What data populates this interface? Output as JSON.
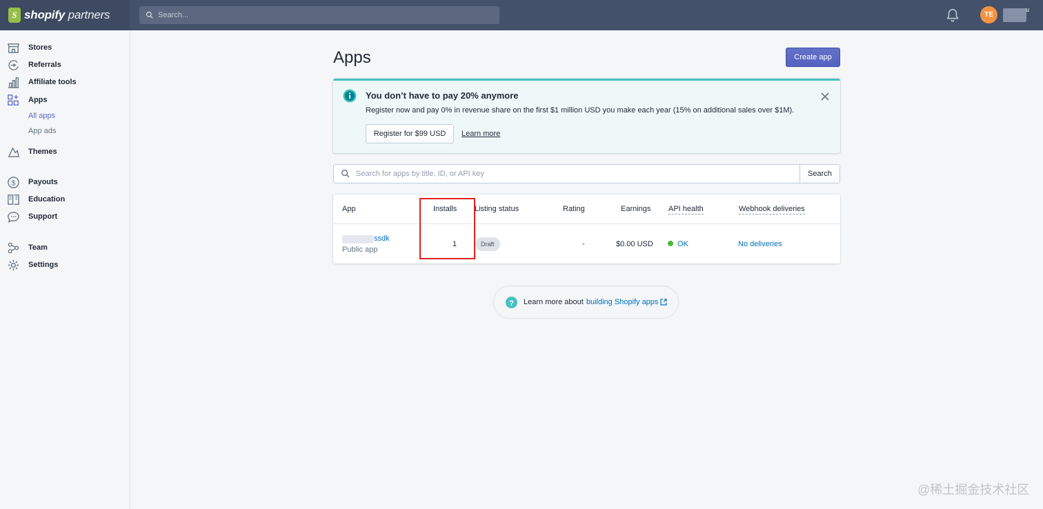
{
  "topbar": {
    "logo_mark": "S",
    "logo_brand": "shopify",
    "logo_product": "partners",
    "search_placeholder": "Search...",
    "avatar_initials": "TE",
    "account_suffix": "u"
  },
  "sidebar": {
    "items": [
      {
        "label": "Stores",
        "icon": "store-icon"
      },
      {
        "label": "Referrals",
        "icon": "referrals-icon"
      },
      {
        "label": "Affiliate tools",
        "icon": "affiliate-tools-icon"
      },
      {
        "label": "Apps",
        "icon": "apps-icon"
      },
      {
        "label": "Themes",
        "icon": "themes-icon"
      },
      {
        "label": "Payouts",
        "icon": "payouts-icon"
      },
      {
        "label": "Education",
        "icon": "education-icon"
      },
      {
        "label": "Support",
        "icon": "support-icon"
      },
      {
        "label": "Team",
        "icon": "team-icon"
      },
      {
        "label": "Settings",
        "icon": "gear-icon"
      }
    ],
    "apps_sub": [
      {
        "label": "All apps",
        "active": true
      },
      {
        "label": "App ads",
        "active": false
      }
    ]
  },
  "main": {
    "title": "Apps",
    "create_button": "Create app",
    "banner": {
      "title": "You don’t have to pay 20% anymore",
      "text": "Register now and pay 0% in revenue share on the first $1 million USD you make each year (15% on additional sales over $1M).",
      "button": "Register for $99 USD",
      "link": "Learn more"
    },
    "search": {
      "placeholder": "Search for apps by title, ID, or API key",
      "button": "Search"
    },
    "table": {
      "headers": {
        "app": "App",
        "installs": "Installs",
        "listing_status": "Listing status",
        "rating": "Rating",
        "earnings": "Earnings",
        "api_health": "API health",
        "webhook": "Webhook deliveries"
      },
      "rows": [
        {
          "name_suffix": "ssdk",
          "type": "Public app",
          "installs": "1",
          "listing_status": "Draft",
          "rating": "-",
          "earnings": "$0.00 USD",
          "api_health": "OK",
          "webhook": "No deliveries"
        }
      ]
    },
    "footer": {
      "text": "Learn more about",
      "link": "building Shopify apps"
    }
  },
  "watermark": "@稀土掘金技术社区",
  "colors": {
    "topbar": "#43516a",
    "primary": "#5c6ac4",
    "link": "#006fbb",
    "banner_bg": "#eef8f9",
    "banner_accent": "#47c1bf",
    "ok_green": "#50b83c",
    "highlight": "#e02020"
  }
}
